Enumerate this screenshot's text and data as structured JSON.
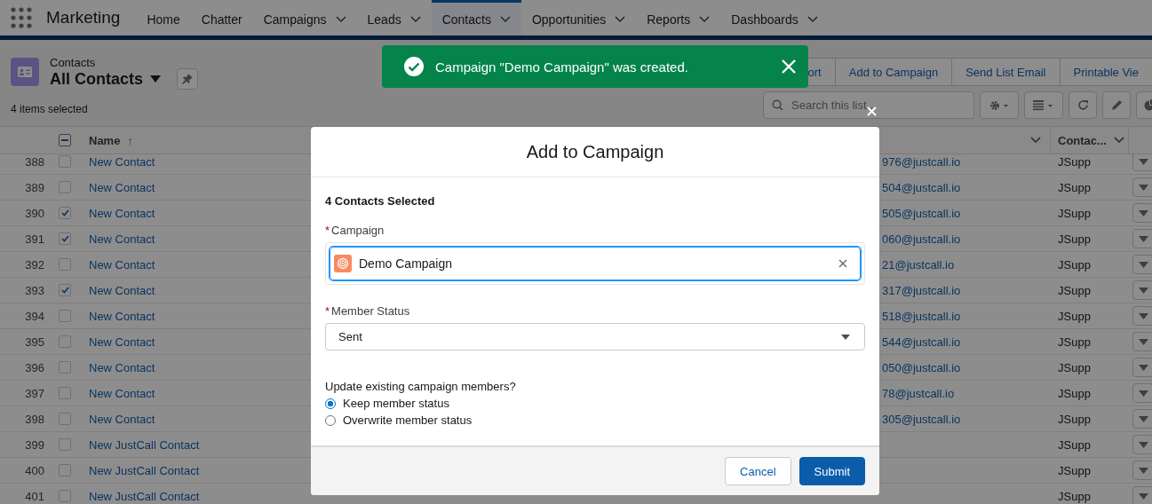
{
  "app_name": "Marketing",
  "nav": [
    {
      "label": "Home",
      "has_menu": false,
      "selected": false
    },
    {
      "label": "Chatter",
      "has_menu": false,
      "selected": false
    },
    {
      "label": "Campaigns",
      "has_menu": true,
      "selected": false
    },
    {
      "label": "Leads",
      "has_menu": true,
      "selected": false
    },
    {
      "label": "Contacts",
      "has_menu": true,
      "selected": true
    },
    {
      "label": "Opportunities",
      "has_menu": true,
      "selected": false
    },
    {
      "label": "Reports",
      "has_menu": true,
      "selected": false
    },
    {
      "label": "Dashboards",
      "has_menu": true,
      "selected": false
    }
  ],
  "list_header": {
    "object": "Contacts",
    "view": "All Contacts",
    "selection_info": "4 items selected"
  },
  "actions": [
    "ort",
    "Add to Campaign",
    "Send List Email",
    "Printable Vie"
  ],
  "search": {
    "placeholder": "Search this list..."
  },
  "table": {
    "select_all_indeterminate": true,
    "columns": [
      {
        "label": "Name",
        "sort_icon": "↑"
      },
      {
        "label": "Contac..."
      }
    ],
    "rows": [
      {
        "number": "388",
        "checked": false,
        "name": "New Contact",
        "email": "976@justcall.io",
        "owner": "JSupp"
      },
      {
        "number": "389",
        "checked": false,
        "name": "New Contact",
        "email": "504@justcall.io",
        "owner": "JSupp"
      },
      {
        "number": "390",
        "checked": true,
        "name": "New Contact",
        "email": "505@justcall.io",
        "owner": "JSupp"
      },
      {
        "number": "391",
        "checked": true,
        "name": "New Contact",
        "email": "060@justcall.io",
        "owner": "JSupp"
      },
      {
        "number": "392",
        "checked": false,
        "name": "New Contact",
        "email": "21@justcall.io",
        "owner": "JSupp"
      },
      {
        "number": "393",
        "checked": true,
        "name": "New Contact",
        "email": "317@justcall.io",
        "owner": "JSupp"
      },
      {
        "number": "394",
        "checked": false,
        "name": "New Contact",
        "email": "518@justcall.io",
        "owner": "JSupp"
      },
      {
        "number": "395",
        "checked": false,
        "name": "New Contact",
        "email": "544@justcall.io",
        "owner": "JSupp"
      },
      {
        "number": "396",
        "checked": false,
        "name": "New Contact",
        "email": "050@justcall.io",
        "owner": "JSupp"
      },
      {
        "number": "397",
        "checked": false,
        "name": "New Contact",
        "email": "78@justcall.io",
        "owner": "JSupp"
      },
      {
        "number": "398",
        "checked": false,
        "name": "New Contact",
        "email": "305@justcall.io",
        "owner": "JSupp"
      },
      {
        "number": "399",
        "checked": false,
        "name": "New JustCall Contact",
        "owner": "JSupp"
      },
      {
        "number": "400",
        "checked": false,
        "name": "New JustCall Contact",
        "owner": "JSupp"
      },
      {
        "number": "401",
        "checked": false,
        "name": "New JustCall Contact",
        "owner": "JSupp"
      }
    ]
  },
  "toast": {
    "message": "Campaign \"Demo Campaign\" was created."
  },
  "modal": {
    "title": "Add to Campaign",
    "selected_count": "4 Contacts Selected",
    "campaign": {
      "label": "Campaign",
      "required_mark": "*",
      "value": "Demo Campaign"
    },
    "member_status": {
      "label": "Member Status",
      "required_mark": "*",
      "value": "Sent"
    },
    "update": {
      "question": "Update existing campaign members?",
      "options": [
        {
          "label": "Keep member status",
          "selected": true
        },
        {
          "label": "Overwrite member status",
          "selected": false
        }
      ]
    },
    "buttons": [
      {
        "label": "Cancel",
        "kind": "neutral"
      },
      {
        "label": "Submit",
        "kind": "brand"
      }
    ]
  }
}
